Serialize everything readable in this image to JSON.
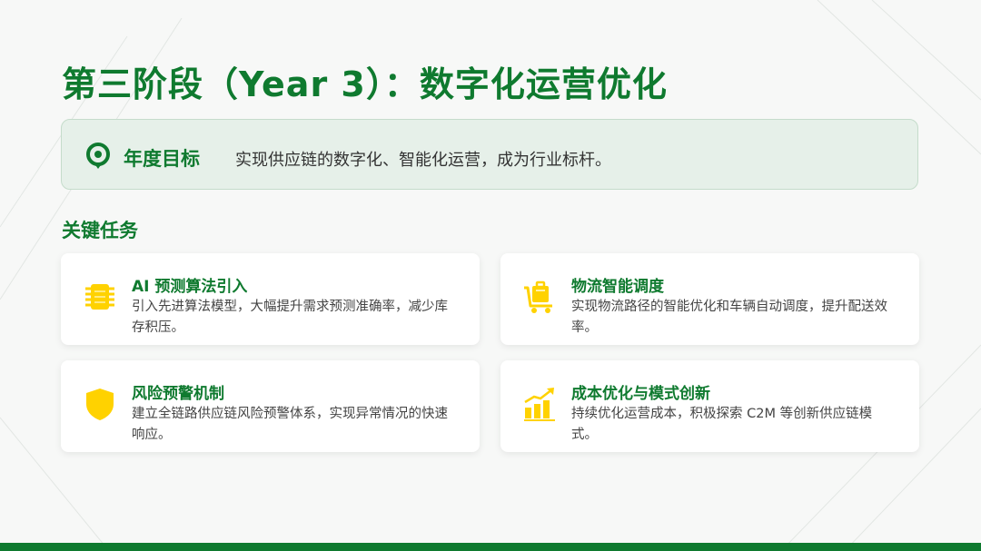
{
  "title": "第三阶段（Year 3）：数字化运营优化",
  "goal": {
    "label": "年度目标",
    "text": "实现供应链的数字化、智能化运营，成为行业标杆。",
    "icon": "target-icon"
  },
  "section_title": "关键任务",
  "cards": [
    {
      "title": "AI 预测算法引入",
      "desc": "引入先进算法模型，大幅提升需求预测准确率，减少库存积压。",
      "icon": "chip-icon"
    },
    {
      "title": "物流智能调度",
      "desc": "实现物流路径的智能优化和车辆自动调度，提升配送效率。",
      "icon": "delivery-cart-icon"
    },
    {
      "title": "风险预警机制",
      "desc": "建立全链路供应链风险预警体系，实现异常情况的快速响应。",
      "icon": "shield-icon"
    },
    {
      "title": "成本优化与模式创新",
      "desc": "持续优化运营成本，积极探索 C2M 等创新供应链模式。",
      "icon": "growth-chart-icon"
    }
  ],
  "colors": {
    "primary_green": "#0f7a2f",
    "icon_yellow": "#ffd200",
    "goal_bg": "#e6f0e9"
  }
}
